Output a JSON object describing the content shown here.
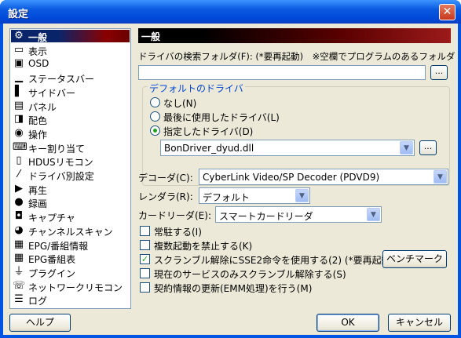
{
  "window": {
    "title": "設定",
    "close_glyph": "✕"
  },
  "sidebar": {
    "items": [
      {
        "label": "一般",
        "icon": "gear-icon",
        "glyph": "⚙"
      },
      {
        "label": "表示",
        "icon": "monitor-icon",
        "glyph": "▭"
      },
      {
        "label": "OSD",
        "icon": "osd-icon",
        "glyph": "▣"
      },
      {
        "label": "ステータスバー",
        "icon": "statusbar-icon",
        "glyph": "▁"
      },
      {
        "label": "サイドバー",
        "icon": "sidebar-icon",
        "glyph": "▌"
      },
      {
        "label": "パネル",
        "icon": "panel-icon",
        "glyph": "▤"
      },
      {
        "label": "配色",
        "icon": "palette-icon",
        "glyph": "◨"
      },
      {
        "label": "操作",
        "icon": "mouse-icon",
        "glyph": "◉"
      },
      {
        "label": "キー割り当て",
        "icon": "keyboard-icon",
        "glyph": "⌨"
      },
      {
        "label": "HDUSリモコン",
        "icon": "remote-icon",
        "glyph": "▯"
      },
      {
        "label": "ドライバ別設定",
        "icon": "driver-icon",
        "glyph": "⁄"
      },
      {
        "label": "再生",
        "icon": "play-icon",
        "glyph": "▶"
      },
      {
        "label": "録画",
        "icon": "record-icon",
        "glyph": "●"
      },
      {
        "label": "キャプチャ",
        "icon": "camera-icon",
        "glyph": "◘"
      },
      {
        "label": "チャンネルスキャン",
        "icon": "scan-icon",
        "glyph": "◕"
      },
      {
        "label": "EPG/番組情報",
        "icon": "epg-icon",
        "glyph": "▦"
      },
      {
        "label": "EPG番組表",
        "icon": "program-guide-icon",
        "glyph": "▦"
      },
      {
        "label": "プラグイン",
        "icon": "plugin-icon",
        "glyph": "⏚"
      },
      {
        "label": "ネットワークリモコン",
        "icon": "network-icon",
        "glyph": "☏"
      },
      {
        "label": "ログ",
        "icon": "log-icon",
        "glyph": "☰"
      }
    ]
  },
  "panel": {
    "header": "一般",
    "driver_folder_label": "ドライバの検索フォルダ(F): (*要再起動)　※空欄でプログラムのあるフォルダ",
    "driver_folder_value": "",
    "browse_label": "...",
    "default_driver_group": "デフォルトのドライバ",
    "radio_none": "なし(N)",
    "radio_last": "最後に使用したドライバ(L)",
    "radio_specified": "指定したドライバ(D)",
    "driver_value": "BonDriver_dyud.dll",
    "decoder_label": "デコーダ(C):",
    "decoder_value": "CyberLink Video/SP Decoder (PDVD9)",
    "renderer_label": "レンダラ(R):",
    "renderer_value": "デフォルト",
    "cardreader_label": "カードリーダ(E):",
    "cardreader_value": "スマートカードリーダ",
    "check_resident": "常駐する(I)",
    "check_multi": "複数起動を禁止する(K)",
    "check_sse2": "スクランブル解除にSSE2命令を使用する(2) (*要再起動)",
    "benchmark_label": "ベンチマーク",
    "check_current_service": "現在のサービスのみスクランブル解除する(S)",
    "check_emm": "契約情報の更新(EMM処理)を行う(M)",
    "sse2_checked": true
  },
  "footer": {
    "help": "ヘルプ",
    "ok": "OK",
    "cancel": "キャンセル"
  }
}
